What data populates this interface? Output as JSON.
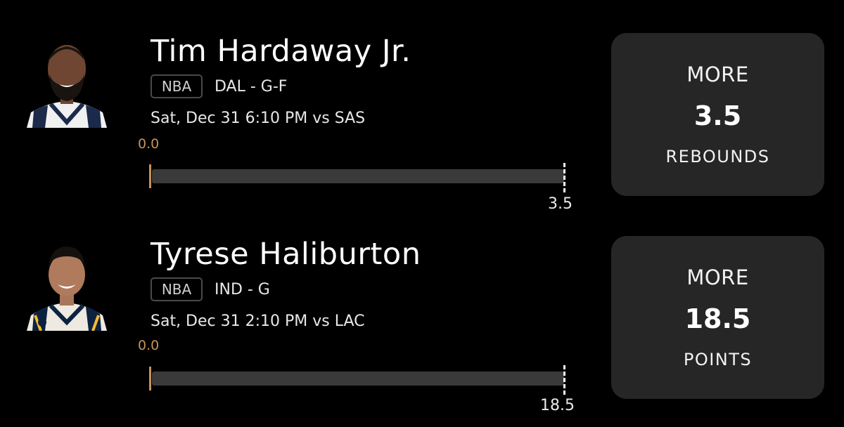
{
  "colors": {
    "background": "#000000",
    "panel": "#262626",
    "accent": "#c8925a",
    "track": "#3a3a3a"
  },
  "props": [
    {
      "player": "Tim Hardaway Jr.",
      "league": "NBA",
      "team_pos": "DAL - G-F",
      "game": "Sat, Dec 31 6:10 PM  vs SAS",
      "progress_label": "0.0",
      "progress_value": 0.0,
      "line_label": "3.5",
      "line_value": 3.5,
      "pick": {
        "direction": "MORE",
        "value": "3.5",
        "stat": "REBOUNDS"
      }
    },
    {
      "player": "Tyrese Haliburton",
      "league": "NBA",
      "team_pos": "IND - G",
      "game": "Sat, Dec 31 2:10 PM  vs LAC",
      "progress_label": "0.0",
      "progress_value": 0.0,
      "line_label": "18.5",
      "line_value": 18.5,
      "pick": {
        "direction": "MORE",
        "value": "18.5",
        "stat": "POINTS"
      }
    }
  ]
}
